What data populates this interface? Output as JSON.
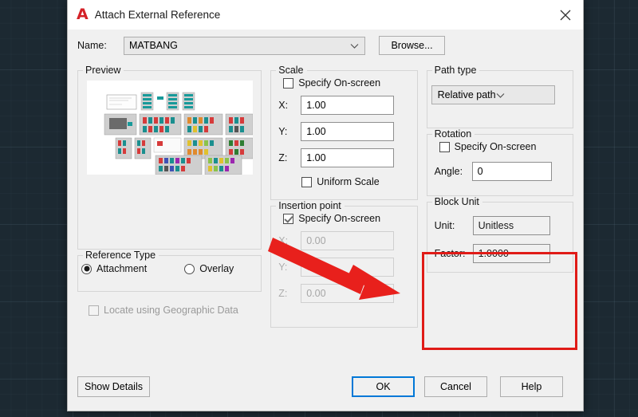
{
  "window": {
    "title": "Attach External Reference",
    "logo_icon": "autocad-a-icon",
    "close_icon": "close-icon"
  },
  "name_row": {
    "label": "Name:",
    "value": "MATBANG",
    "dropdown_icon": "chevron-down-icon",
    "browse_label": "Browse..."
  },
  "preview": {
    "legend": "Preview"
  },
  "reference_type": {
    "legend": "Reference Type",
    "options": [
      {
        "label": "Attachment",
        "selected": true
      },
      {
        "label": "Overlay",
        "selected": false
      }
    ]
  },
  "locate_geographic": {
    "label": "Locate using Geographic Data",
    "checked": false,
    "disabled": true
  },
  "scale": {
    "legend": "Scale",
    "specify_onscreen": {
      "label": "Specify On-screen",
      "checked": false
    },
    "x": {
      "label": "X:",
      "value": "1.00"
    },
    "y": {
      "label": "Y:",
      "value": "1.00"
    },
    "z": {
      "label": "Z:",
      "value": "1.00"
    },
    "uniform_scale": {
      "label": "Uniform Scale",
      "checked": false
    }
  },
  "insertion_point": {
    "legend": "Insertion point",
    "specify_onscreen": {
      "label": "Specify On-screen",
      "checked": true
    },
    "x": {
      "label": "X:",
      "value": "0.00",
      "disabled": true
    },
    "y": {
      "label": "Y:",
      "value": "0.00",
      "disabled": true
    },
    "z": {
      "label": "Z:",
      "value": "0.00",
      "disabled": true
    }
  },
  "path_type": {
    "legend": "Path type",
    "value": "Relative path",
    "dropdown_icon": "chevron-down-icon"
  },
  "rotation": {
    "legend": "Rotation",
    "specify_onscreen": {
      "label": "Specify On-screen",
      "checked": false
    },
    "angle": {
      "label": "Angle:",
      "value": "0"
    }
  },
  "block_unit": {
    "legend": "Block Unit",
    "unit": {
      "label": "Unit:",
      "value": "Unitless"
    },
    "factor": {
      "label": "Factor:",
      "value": "1.0000"
    },
    "highlight_color": "#e01b17"
  },
  "annotation": {
    "arrow_color": "#e8201c",
    "arrow_name": "red-pointer-arrow"
  },
  "footer": {
    "show_details": "Show Details",
    "ok": "OK",
    "cancel": "Cancel",
    "help": "Help",
    "focus_color": "#0078d7"
  }
}
